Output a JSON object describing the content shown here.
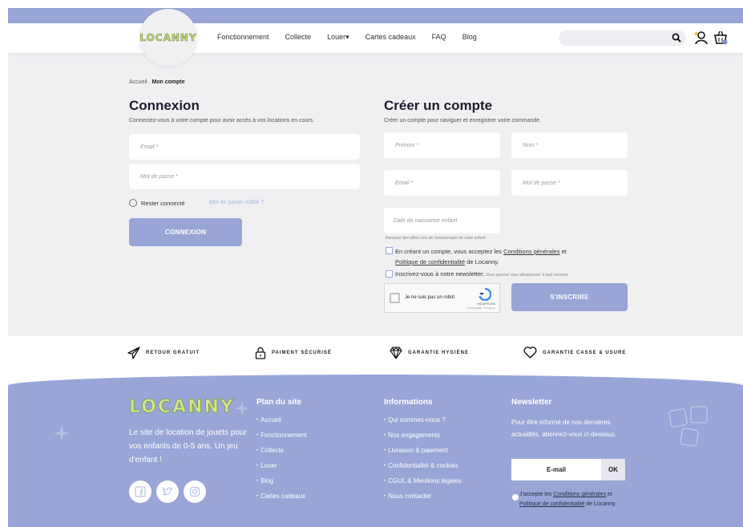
{
  "header": {
    "logo": "LOCANNY",
    "nav": [
      "Fonctionnement",
      "Collecte",
      "Louer",
      "Cartes cadeaux",
      "FAQ",
      "Blog"
    ],
    "louer_caret": "▾",
    "search": {
      "placeholder": ""
    },
    "icons": [
      "search-icon",
      "user-icon",
      "basket-icon"
    ]
  },
  "breadcrumb": {
    "home": "Accueil",
    "sep": ".",
    "current": "Mon compte"
  },
  "login": {
    "title": "Connexion",
    "subtitle": "Connectez-vous à votre compte pour avoir accès à vos locations en cours.",
    "email_placeholder": "Email *",
    "password_placeholder": "Mot de passe *",
    "remember": "Rester connecté",
    "forgot": "Mot de passe oublié ?",
    "button": "CONNEXION"
  },
  "register": {
    "title": "Créer un compte",
    "subtitle": "Créer un compte pour naviguer et enregistrer votre commande.",
    "firstname_placeholder": "Prénom *",
    "lastname_placeholder": "Nom *",
    "email_placeholder": "Email *",
    "password_placeholder": "Mot de passe *",
    "birthdate_placeholder": "Date de naissance enfant",
    "birthdate_hint": "Recevez des offres lors de l'anniversaire de votre enfant",
    "terms_before": "En créant un compte, vous acceptez les ",
    "terms_link": "Conditions générales",
    "terms_mid": " et",
    "privacy_link": "Politique de confidentialité",
    "terms_after": " de Locanny.",
    "newsletter": "Inscrivez-vous à notre newsletter.",
    "newsletter_hint": "Vous pouvez vous désabonner à tout moment.",
    "captcha_label": "Je ne suis pas un robot",
    "captcha_brand": "reCAPTCHA",
    "captcha_links": "Confidentialité - Conditions",
    "button": "S'INSCRIRE"
  },
  "features": [
    {
      "icon": "paper-plane-icon",
      "label": "RETOUR GRATUIT"
    },
    {
      "icon": "lock-icon",
      "label": "PAIMENT SÉCURISÉ"
    },
    {
      "icon": "diamond-icon",
      "label": "GARANTIE HYGIÈNE"
    },
    {
      "icon": "heart-icon",
      "label": "GARANTIE CASSE & USURE"
    }
  ],
  "footer": {
    "logo": "LOCANNY",
    "description": "Le site de location de jouets pour vos enfants de 0-5 ans. Un jeu d'enfant !",
    "social": [
      "facebook-icon",
      "twitter-icon",
      "instagram-icon"
    ],
    "sitemap": {
      "title": "Plan du site",
      "items": [
        "Accueil",
        "Fonctionnement",
        "Collecte",
        "Louer",
        "Blog",
        "Cartes cadeaux"
      ]
    },
    "info": {
      "title": "Informations",
      "items": [
        "Qui sommes-nous ?",
        "Nos engagements",
        "Livraison & paiement",
        "Confidentialité & cookies",
        "CGUL & Mentions légales",
        "Nous contacter"
      ]
    },
    "newsletter": {
      "title": "Newsletter",
      "text": "Pour être informé de nos dernières actualités, abonnez-vous ci-dessous.",
      "email_label": "E-mail",
      "ok": "OK",
      "consent_before": "J'accepte les ",
      "consent_link1": "Conditions générales",
      "consent_mid": " et",
      "consent_link2": "Politique de confidentialité",
      "consent_after": " de Locanny."
    }
  },
  "colors": {
    "accent": "#98a5d6",
    "logo_green": "#c7dd84",
    "background": "#f0f0f3"
  }
}
